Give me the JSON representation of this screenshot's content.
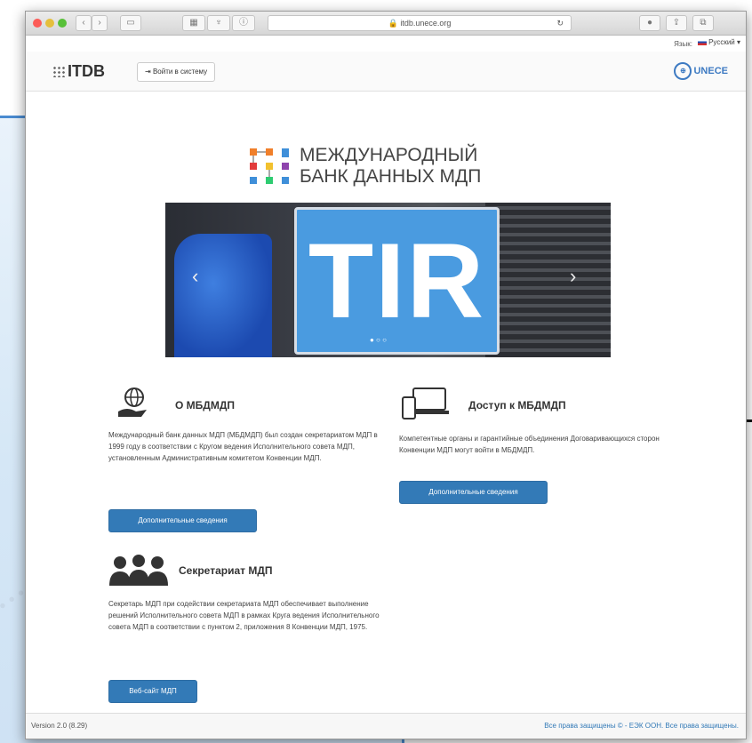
{
  "browser": {
    "url": "itdb.unece.org",
    "buttons": {
      "back": "‹",
      "forward": "›",
      "sidebar": "▭",
      "share": "⇪",
      "tabs": "⧉"
    }
  },
  "language": {
    "label": "Язык:",
    "selected": "Русский ▾"
  },
  "navbar": {
    "logo_text": "ITDB",
    "login_label": "Войти в систему",
    "unece_label": "UNECE"
  },
  "hero": {
    "line1": "МЕЖДУНАРОДНЫЙ",
    "line2": "БАНК ДАННЫХ МДП"
  },
  "carousel": {
    "plate_text": "TIR",
    "prev": "‹",
    "next": "›",
    "dots": "● ○ ○"
  },
  "about": {
    "title": "О МБДМДП",
    "text": "Международный банк данных МДП (МБДМДП) был создан секретариатом МДП в 1999 году в соответствии с Кругом ведения Исполнительного совета МДП, установленным Административным комитетом Конвенции МДП.",
    "button": "Дополнительные сведения"
  },
  "access": {
    "title": "Доступ к МБДМДП",
    "text": "Компетентные органы и гарантийные объединения Договаривающихся сторон Конвенции МДП могут войти в МБДМДП.",
    "button": "Дополнительные сведения"
  },
  "secretariat": {
    "title": "Секретариат МДП",
    "text": "Секретарь МДП при содействии секретариата МДП обеспечивает выполнение решений Исполнительного совета МДП в рамках Круга ведения Исполнительного совета МДП в соответствии с пунктом 2, приложения 8 Конвенции МДП, 1975.",
    "button": "Веб-сайт МДП"
  },
  "footer": {
    "version": "Version 2.0 (8.29)",
    "rights": "Все права защищены © - ЕЭК ООН. Все права защищены."
  }
}
